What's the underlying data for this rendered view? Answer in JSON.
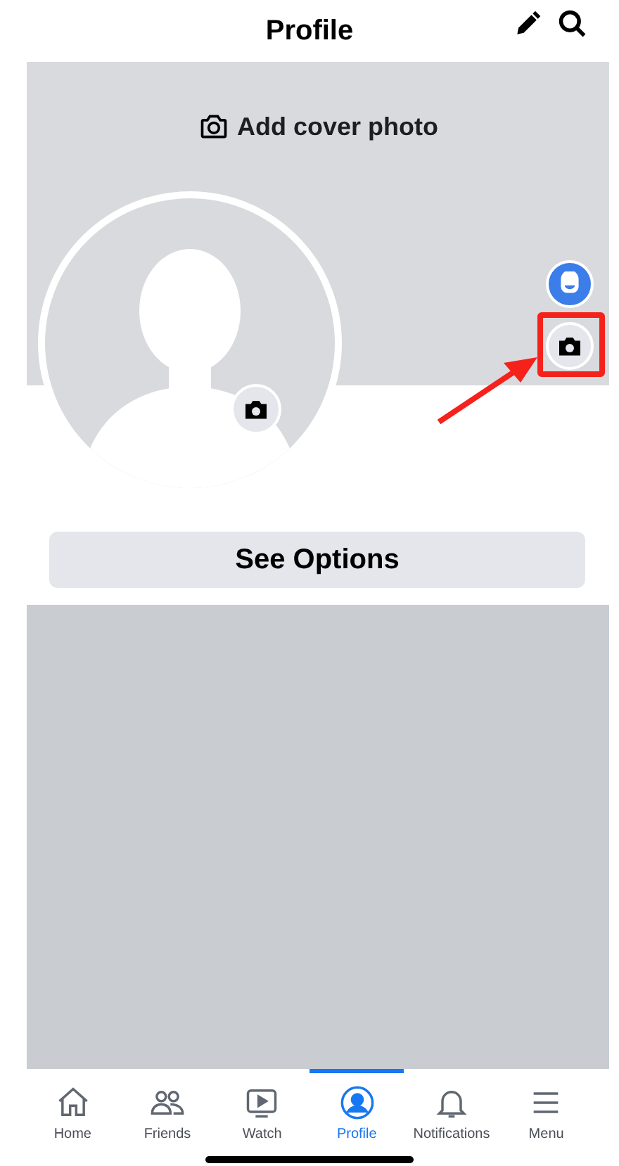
{
  "header": {
    "title": "Profile"
  },
  "cover": {
    "add_label": "Add cover photo"
  },
  "options_button": "See Options",
  "tab_bar": [
    {
      "label": "Home",
      "kind": "home",
      "selected": false
    },
    {
      "label": "Friends",
      "kind": "friends",
      "selected": false
    },
    {
      "label": "Watch",
      "kind": "watch",
      "selected": false
    },
    {
      "label": "Profile",
      "kind": "profile",
      "selected": true
    },
    {
      "label": "Notifications",
      "kind": "bell",
      "selected": false
    },
    {
      "label": "Menu",
      "kind": "menu",
      "selected": false
    }
  ]
}
